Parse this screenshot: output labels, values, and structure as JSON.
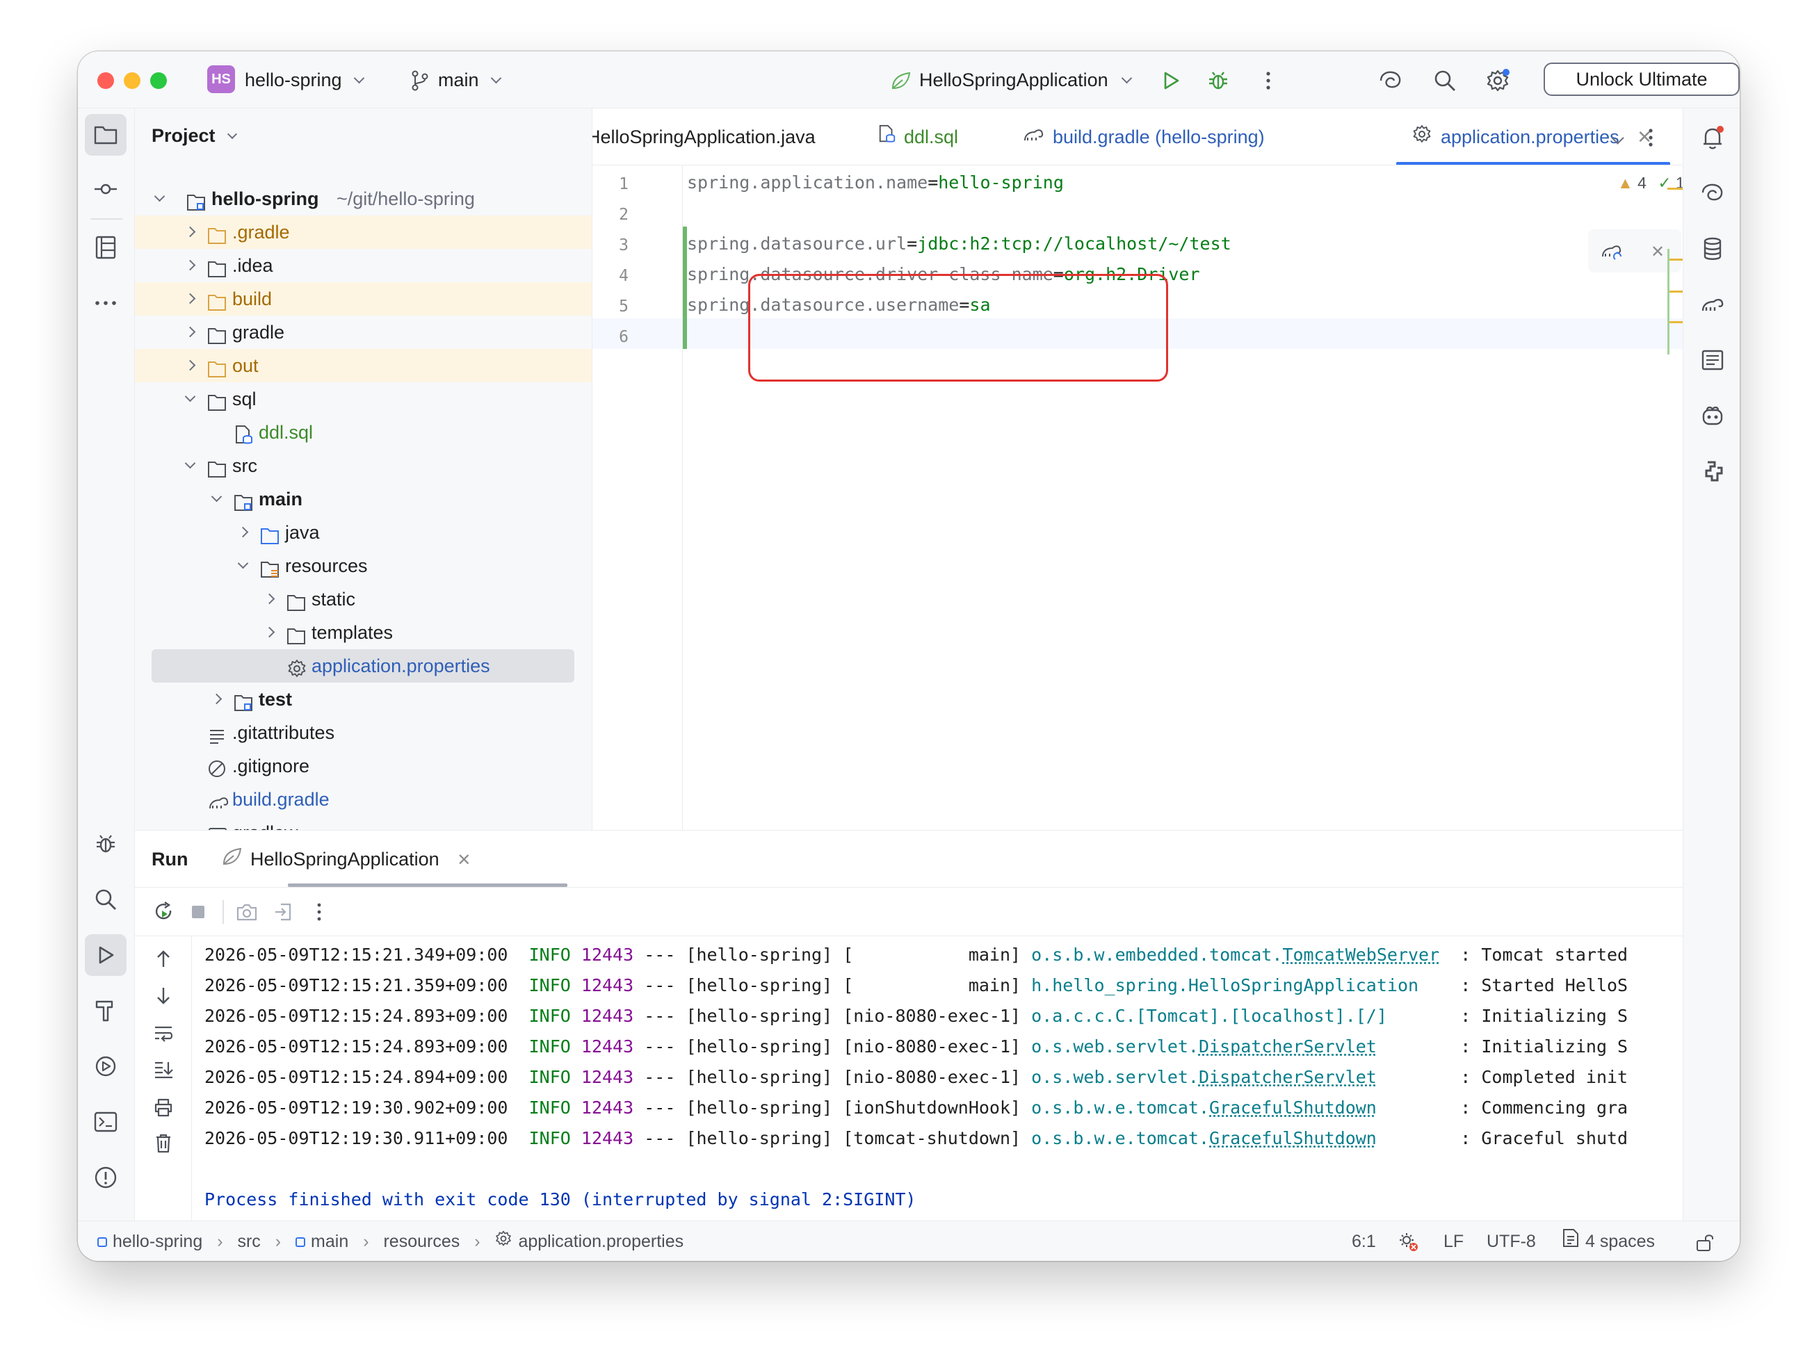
{
  "titlebar": {
    "project_badge": "HS",
    "project_name": "hello-spring",
    "branch": "main",
    "run_config": "HelloSpringApplication",
    "unlock_label": "Unlock Ultimate"
  },
  "project_panel": {
    "title": "Project",
    "tree": [
      {
        "label": "hello-spring",
        "suffix": "~/git/hello-spring",
        "bold": true
      },
      {
        "label": ".gradle"
      },
      {
        "label": ".idea"
      },
      {
        "label": "build"
      },
      {
        "label": "gradle"
      },
      {
        "label": "out"
      },
      {
        "label": "sql"
      },
      {
        "label": "ddl.sql"
      },
      {
        "label": "src"
      },
      {
        "label": "main"
      },
      {
        "label": "java"
      },
      {
        "label": "resources"
      },
      {
        "label": "static"
      },
      {
        "label": "templates"
      },
      {
        "label": "application.properties"
      },
      {
        "label": "test"
      },
      {
        "label": ".gitattributes"
      },
      {
        "label": ".gitignore"
      },
      {
        "label": "build.gradle"
      },
      {
        "label": "gradlew"
      }
    ]
  },
  "tabs": [
    {
      "label": "HelloSpringApplication.java"
    },
    {
      "label": "ddl.sql"
    },
    {
      "label": "build.gradle (hello-spring)"
    },
    {
      "label": "application.properties"
    }
  ],
  "editor": {
    "line_numbers": [
      "1",
      "2",
      "3",
      "4",
      "5",
      "6"
    ],
    "lines": [
      {
        "key": "spring.application.name",
        "eq": "=",
        "value": "hello-spring"
      },
      {
        "key": "",
        "eq": "",
        "value": ""
      },
      {
        "key": "spring.datasource.url",
        "eq": "=",
        "value": "jdbc:h2:tcp://localhost/~/test"
      },
      {
        "key": "spring.datasource.driver-class-name",
        "eq": "=",
        "value": "org.h2.Driver"
      },
      {
        "key": "spring.datasource.username",
        "eq": "=",
        "value": "sa"
      },
      {
        "key": "",
        "eq": "",
        "value": ""
      }
    ],
    "warnings_count": "4",
    "checks_count": "1"
  },
  "run": {
    "title": "Run",
    "tab_label": "HelloSpringApplication",
    "logs": [
      {
        "ts": "2026-05-09T12:15:21.349+09:00",
        "level": "INFO",
        "pid": "12443",
        "sep": "---",
        "app": "[hello-spring]",
        "thread": "[           main]",
        "logger_prefix": "o.s.b.w.embedded.tomcat.",
        "logger_class": "TomcatWebServer",
        "pad": "  ",
        "msg": ": Tomcat started"
      },
      {
        "ts": "2026-05-09T12:15:21.359+09:00",
        "level": "INFO",
        "pid": "12443",
        "sep": "---",
        "app": "[hello-spring]",
        "thread": "[           main]",
        "logger_prefix": "h.hello_spring.HelloSpringApplication",
        "logger_class": "",
        "pad": "    ",
        "msg": ": Started HelloS"
      },
      {
        "ts": "2026-05-09T12:15:24.893+09:00",
        "level": "INFO",
        "pid": "12443",
        "sep": "---",
        "app": "[hello-spring]",
        "thread": "[nio-8080-exec-1]",
        "logger_prefix": "o.a.c.c.C.[Tomcat].[localhost].[/]",
        "logger_class": "",
        "pad": "       ",
        "msg": ": Initializing S"
      },
      {
        "ts": "2026-05-09T12:15:24.893+09:00",
        "level": "INFO",
        "pid": "12443",
        "sep": "---",
        "app": "[hello-spring]",
        "thread": "[nio-8080-exec-1]",
        "logger_prefix": "o.s.web.servlet.",
        "logger_class": "DispatcherServlet",
        "pad": "        ",
        "msg": ": Initializing S"
      },
      {
        "ts": "2026-05-09T12:15:24.894+09:00",
        "level": "INFO",
        "pid": "12443",
        "sep": "---",
        "app": "[hello-spring]",
        "thread": "[nio-8080-exec-1]",
        "logger_prefix": "o.s.web.servlet.",
        "logger_class": "DispatcherServlet",
        "pad": "        ",
        "msg": ": Completed init"
      },
      {
        "ts": "2026-05-09T12:19:30.902+09:00",
        "level": "INFO",
        "pid": "12443",
        "sep": "---",
        "app": "[hello-spring]",
        "thread": "[ionShutdownHook]",
        "logger_prefix": "o.s.b.w.e.tomcat.",
        "logger_class": "GracefulShutdown",
        "pad": "        ",
        "msg": ": Commencing gra"
      },
      {
        "ts": "2026-05-09T12:19:30.911+09:00",
        "level": "INFO",
        "pid": "12443",
        "sep": "---",
        "app": "[hello-spring]",
        "thread": "[tomcat-shutdown]",
        "logger_prefix": "o.s.b.w.e.tomcat.",
        "logger_class": "GracefulShutdown",
        "pad": "        ",
        "msg": ": Graceful shutd"
      }
    ],
    "process_line": "Process finished with exit code 130 (interrupted by signal 2:SIGINT)"
  },
  "statusbar": {
    "crumbs": [
      "hello-spring",
      "src",
      "main",
      "resources",
      "application.properties"
    ],
    "position": "6:1",
    "line_sep": "LF",
    "encoding": "UTF-8",
    "indent": "4 spaces"
  },
  "colors": {
    "accent": "#3574f0",
    "highlight_box": "#e0332f",
    "string_value": "#067d17",
    "excluded_bg": "#fdf5e2"
  }
}
